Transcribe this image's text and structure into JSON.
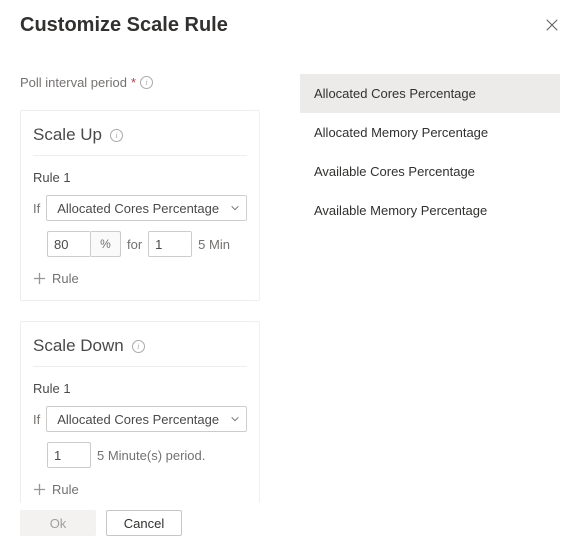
{
  "header": {
    "title": "Customize Scale Rule"
  },
  "poll": {
    "label": "Poll interval period",
    "required_marker": "*"
  },
  "scaleUp": {
    "title": "Scale Up",
    "rule_label": "Rule 1",
    "if_label": "If",
    "metric": "Allocated Cores Percentage",
    "threshold_value": "80",
    "threshold_unit": "%",
    "for_label": "for",
    "duration_value": "1",
    "duration_suffix": "5 Min",
    "add_rule_label": "Rule"
  },
  "scaleDown": {
    "title": "Scale Down",
    "rule_label": "Rule 1",
    "if_label": "If",
    "metric": "Allocated Cores Percentage",
    "duration_value": "1",
    "duration_suffix": "5 Minute(s) period.",
    "add_rule_label": "Rule"
  },
  "footer": {
    "ok_label": "Ok",
    "cancel_label": "Cancel"
  },
  "dropdown": {
    "options": [
      "Allocated Cores Percentage",
      "Allocated Memory Percentage",
      "Available Cores Percentage",
      "Available Memory Percentage"
    ],
    "selected_index": 0
  }
}
